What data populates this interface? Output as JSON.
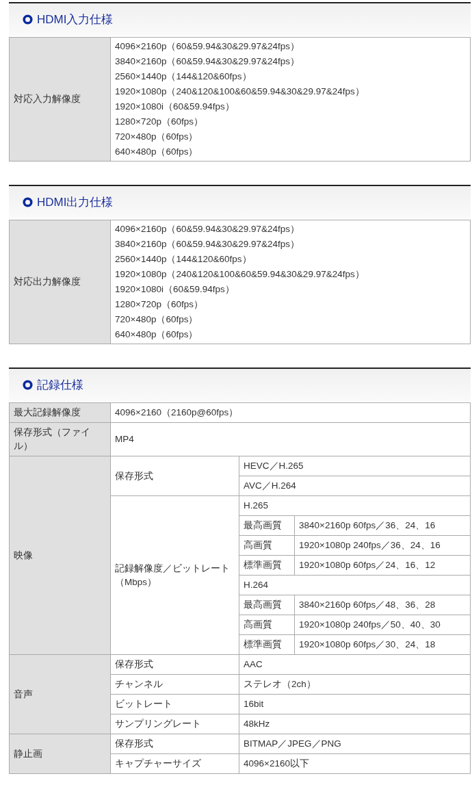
{
  "sections": [
    {
      "title": "HDMI入力仕様",
      "kind": "list",
      "rows": [
        {
          "label": "対応入力解像度",
          "lines": [
            "4096×2160p（60&59.94&30&29.97&24fps）",
            "3840×2160p（60&59.94&30&29.97&24fps）",
            "2560×1440p（144&120&60fps）",
            "1920×1080p（240&120&100&60&59.94&30&29.97&24fps）",
            "1920×1080i（60&59.94fps）",
            "1280×720p（60fps）",
            "720×480p（60fps）",
            "640×480p（60fps）"
          ]
        }
      ]
    },
    {
      "title": "HDMI出力仕様",
      "kind": "list",
      "rows": [
        {
          "label": "対応出力解像度",
          "lines": [
            "4096×2160p（60&59.94&30&29.97&24fps）",
            "3840×2160p（60&59.94&30&29.97&24fps）",
            "2560×1440p（144&120&60fps）",
            "1920×1080p（240&120&100&60&59.94&30&29.97&24fps）",
            "1920×1080i（60&59.94fps）",
            "1280×720p（60fps）",
            "720×480p（60fps）",
            "640×480p（60fps）"
          ]
        }
      ]
    },
    {
      "title": "記録仕様",
      "kind": "nested",
      "rows": [
        {
          "label": "最大記録解像度",
          "value": "4096×2160（2160p@60fps）"
        },
        {
          "label": "保存形式（ファイル）",
          "value": "MP4"
        },
        {
          "label": "映像",
          "children": [
            {
              "label": "保存形式",
              "values": [
                "HEVC／H.265",
                "AVC／H.264"
              ]
            },
            {
              "label": "記録解像度／ビットレート（Mbps）",
              "codecs": [
                {
                  "name": "H.265",
                  "qualities": [
                    {
                      "label": "最高画質",
                      "value": "3840×2160p 60fps／36、24、16"
                    },
                    {
                      "label": "高画質",
                      "value": "1920×1080p 240fps／36、24、16"
                    },
                    {
                      "label": "標準画質",
                      "value": "1920×1080p 60fps／24、16、12"
                    }
                  ]
                },
                {
                  "name": "H.264",
                  "qualities": [
                    {
                      "label": "最高画質",
                      "value": "3840×2160p 60fps／48、36、28"
                    },
                    {
                      "label": "高画質",
                      "value": "1920×1080p 240fps／50、40、30"
                    },
                    {
                      "label": "標準画質",
                      "value": "1920×1080p 60fps／30、24、18"
                    }
                  ]
                }
              ]
            }
          ]
        },
        {
          "label": "音声",
          "children": [
            {
              "label": "保存形式",
              "values": [
                "AAC"
              ]
            },
            {
              "label": "チャンネル",
              "values": [
                "ステレオ（2ch）"
              ]
            },
            {
              "label": "ビットレート",
              "values": [
                "16bit"
              ]
            },
            {
              "label": "サンプリングレート",
              "values": [
                "48kHz"
              ]
            }
          ]
        },
        {
          "label": "静止画",
          "children": [
            {
              "label": "保存形式",
              "values": [
                "BITMAP／JPEG／PNG"
              ]
            },
            {
              "label": "キャプチャーサイズ",
              "values": [
                "4096×2160以下"
              ]
            }
          ]
        }
      ]
    }
  ]
}
